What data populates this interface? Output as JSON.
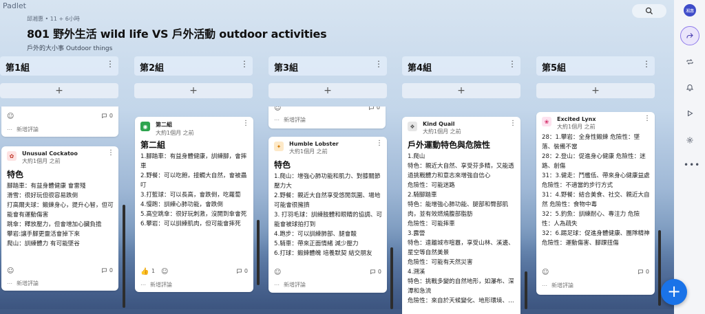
{
  "brand": "Padlet",
  "header": {
    "meta": "邱湘惠 • 11 + 6小時",
    "title": "801 野外生活  wild life  VS 戶外活動 outdoor activities",
    "subtitle": "戶外的大小事 Outdoor things"
  },
  "rail": {
    "avatar": "湘惠"
  },
  "common": {
    "add_comment": "新增評論",
    "add_post": "+",
    "menu": "⋮",
    "fab": "+"
  },
  "columns": [
    {
      "title": "第1組"
    },
    {
      "title": "第2組"
    },
    {
      "title": "第3組"
    },
    {
      "title": "第4組"
    },
    {
      "title": "第5組"
    }
  ],
  "cards": {
    "c1a": {
      "comments": "0"
    },
    "c1b": {
      "author": "Unusual Cockatoo",
      "time": "大約1個月 之前",
      "heading": "特色",
      "text": "腳踏車：有益身體健康 會雷殘\n滑雪：很好玩但很容易跌倒\n打高爾夫球：鍛鍊身心，提升心智，但可能會有運動傷害\n跳傘：釋放壓力，但會增加心臟負擔\n攀岩:讓手腳更靈活會掉下來\n爬山：訓練體力 有可能墜谷",
      "comments": "0"
    },
    "c2a": {
      "author": "第二組",
      "time": "大約1個月 之前",
      "heading": "第二組",
      "text": "1.腳踏車：有益身體健康，訓練腳，會摔車\n2.野餐：可以吃飽，接觸大自然，會被蟲叮\n3.打籃球：可以長高，會跌倒，吃蘿蔔\n4.慢跑：訓練心肺功能，會跌倒\n5.高空跳傘：很好玩刺激，沒開到傘會死\n6.攀岩：可以訓練肌肉，但可能會摔死",
      "likes": "1",
      "comments": "0"
    },
    "c3a": {
      "comments": "0"
    },
    "c3b": {
      "author": "Humble Lobster",
      "time": "大約1個月 之前",
      "heading": "特色",
      "text": "1.爬山：增強心肺功能和肌力、對膝關節壓力大\n2.野餐：親近大自然享受悠閒氛圍、場地可能會很擁擠\n3. 打羽毛球：訓練肢體和眼睛的協調、可能會被球拍打到\n4.跑步：可以訓練肺部、腿會酸\n5.騎車：帶來正面情緒 減少壓力\n6.打球：鍛鍊體魄 培養默契 結交朋友",
      "comments": "0"
    },
    "c4a": {
      "author": "Kind Quail",
      "time": "大約1個月 之前",
      "heading": "戶外運動特色與危險性",
      "text": "1.爬山\n特色：親近大自然、享受芬多精，又能透過挑戰體力和意志來增強自信心\n危險性：可能迷路\n2.騎腳踏車\n特色：能增強心肺功能、腿部和臀部肌肉，並有效燃燒腹部脂肪\n危險性：可能摔車\n3.露營\n特色：遠離城市喧囂，享受山林、溪邊、星空等自然美景\n危險性：可能有天然災害\n4.溯溪\n特色：挑戰多變的自然地形，如瀑布、深潭和急流\n危險性：來自於天候變化、地形環境、…"
    },
    "c5a": {
      "author": "Excited Lynx",
      "time": "大約1個月 之前",
      "text": "28：1.攀岩：全身性鍛鍊 危險性：墜落、裝備不當\n28：2.登山：促進身心健康 危險性：迷路、創傷\n31：3.健走：鬥艦低、帶來身心健康益處 危險性：不適當的步行方式\n31：4.野餐：結合美食、社交、親近大自然 危險性：食物中毒\n32：5.釣魚：訓練耐心、專注力 危險性：人為疏失\n32：6.踢足球：促進身體健康、團隊精神 危險性：運動傷害、腳踝扭傷",
      "comments": "0"
    }
  },
  "colors": {
    "accent": "#1a73e8",
    "rail_active": "#8f7bea",
    "avatar_bg": "#3f4cc9"
  }
}
